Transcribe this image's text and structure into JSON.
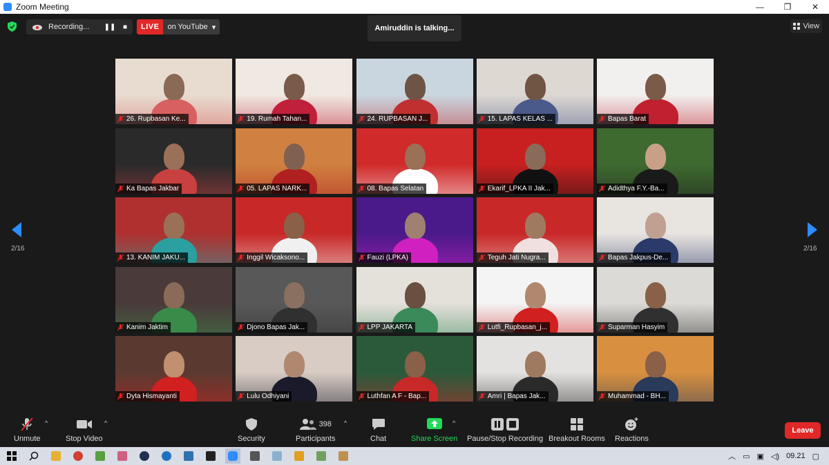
{
  "window": {
    "title": "Zoom Meeting",
    "minimize": "—",
    "restore": "❐",
    "close": "✕"
  },
  "topbar": {
    "recording_label": "Recording...",
    "pause_glyph": "❚❚",
    "stop_glyph": "■",
    "live_badge": "LIVE",
    "live_target": "on YouTube",
    "live_caret": "▾",
    "talking": "Amiruddin is talking...",
    "view_label": "View"
  },
  "navigation": {
    "page_left": "2/16",
    "page_right": "2/16"
  },
  "participants": [
    {
      "name": "26. Rupbasan Ke...",
      "bg": "#e8dcd0",
      "accent": "#d86060",
      "skin": "#8a6a55"
    },
    {
      "name": "19. Rumah Tahan...",
      "bg": "#f0e8e2",
      "accent": "#c0203a",
      "skin": "#7a5a48"
    },
    {
      "name": "24. RUPBASAN J...",
      "bg": "#c9d6e0",
      "accent": "#c03030",
      "skin": "#6e5444"
    },
    {
      "name": "15. LAPAS KELAS ...",
      "bg": "#ddd8d2",
      "accent": "#4a5a8a",
      "skin": "#705444"
    },
    {
      "name": "Bapas Barat",
      "bg": "#f2f0ee",
      "accent": "#c02030",
      "skin": "#7a5a48"
    },
    {
      "name": "Ka Bapas Jakbar",
      "bg": "#2a2a2a",
      "accent": "#c84040",
      "skin": "#9a7058"
    },
    {
      "name": "05. LAPAS NARK...",
      "bg": "#d08040",
      "accent": "#b02020",
      "skin": "#806050"
    },
    {
      "name": "08. Bapas Selatan",
      "bg": "#d02a2a",
      "accent": "#ffffff",
      "skin": "#9a7056"
    },
    {
      "name": "Ekarif_LPKA II Jak...",
      "bg": "#c82020",
      "accent": "#111111",
      "skin": "#8a6a58"
    },
    {
      "name": "Adidthya F.Y.-Ba...",
      "bg": "#3e6a30",
      "accent": "#1a1a1a",
      "skin": "#c8a088"
    },
    {
      "name": "13. KANIM JAKU...",
      "bg": "#b03030",
      "accent": "#2aa0a0",
      "skin": "#9a7056"
    },
    {
      "name": "Inggil Wicaksono...",
      "bg": "#c82828",
      "accent": "#f0f0f0",
      "skin": "#8a6048"
    },
    {
      "name": "Fauzi (LPKA)",
      "bg": "#4a1a8a",
      "accent": "#d020c0",
      "skin": "#a08070"
    },
    {
      "name": "Teguh Jati Nugra...",
      "bg": "#c82828",
      "accent": "#f0e0e0",
      "skin": "#a07a60"
    },
    {
      "name": "Bapas Jakpus-De...",
      "bg": "#e8e4e0",
      "accent": "#2a3a6a",
      "skin": "#c0a090"
    },
    {
      "name": "Kanim Jaktim",
      "bg": "#4a3a3a",
      "accent": "#3a8a4a",
      "skin": "#8a6a58"
    },
    {
      "name": "Djono Bapas Jak...",
      "bg": "#585858",
      "accent": "#303030",
      "skin": "#8a7060"
    },
    {
      "name": "LPP JAKARTA",
      "bg": "#e4e0da",
      "accent": "#3a8a5a",
      "skin": "#6a5040"
    },
    {
      "name": "Lutfi_Rupbasan_j...",
      "bg": "#f4f4f4",
      "accent": "#d02020",
      "skin": "#b08870"
    },
    {
      "name": "Suparman Hasyim",
      "bg": "#dcdad6",
      "accent": "#303030",
      "skin": "#8a6048"
    },
    {
      "name": "Dyta Hismayanti",
      "bg": "#5a3a30",
      "accent": "#d02020",
      "skin": "#c09070"
    },
    {
      "name": "Lulu Odhiyani",
      "bg": "#d8ccc4",
      "accent": "#1a1a2a",
      "skin": "#b08870"
    },
    {
      "name": "Luthfan A F - Bap...",
      "bg": "#2a5a3a",
      "accent": "#c82828",
      "skin": "#8a6048"
    },
    {
      "name": "Amri | Bapas Jak...",
      "bg": "#e4e2e0",
      "accent": "#2a2a2a",
      "skin": "#a07a60"
    },
    {
      "name": "Muhammad - BH...",
      "bg": "#d89040",
      "accent": "#2a3a5a",
      "skin": "#8a6048"
    }
  ],
  "toolbar": {
    "unmute": "Unmute",
    "stop_video": "Stop Video",
    "security": "Security",
    "participants": "Participants",
    "participant_count": "398",
    "chat": "Chat",
    "share_screen": "Share Screen",
    "pause_stop_recording": "Pause/Stop Recording",
    "breakout_rooms": "Breakout Rooms",
    "reactions": "Reactions",
    "leave": "Leave",
    "caret": "^"
  },
  "taskbar": {
    "time": "09.21"
  },
  "colors": {
    "accent_green": "#23d959",
    "accent_blue": "#2d8cff",
    "live_red": "#e02828",
    "mute_red": "#e02828"
  }
}
